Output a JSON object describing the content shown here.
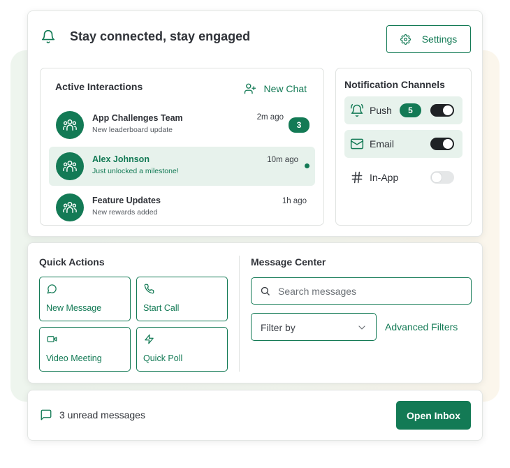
{
  "header": {
    "title": "Stay connected, stay engaged",
    "settings_label": "Settings"
  },
  "interactions": {
    "title": "Active Interactions",
    "new_chat_label": "New Chat",
    "items": [
      {
        "name": "App Challenges Team",
        "subtitle": "New leaderboard update",
        "time": "2m ago",
        "badge": "3"
      },
      {
        "name": "Alex Johnson",
        "subtitle": "Just unlocked a milestone!",
        "time": "10m ago"
      },
      {
        "name": "Feature Updates",
        "subtitle": "New rewards added",
        "time": "1h ago"
      }
    ]
  },
  "channels": {
    "title": "Notification Channels",
    "items": [
      {
        "label": "Push",
        "badge": "5",
        "enabled": true
      },
      {
        "label": "Email",
        "enabled": true
      },
      {
        "label": "In-App",
        "enabled": false
      }
    ]
  },
  "quick_actions": {
    "title": "Quick Actions",
    "items": [
      {
        "label": "New Message"
      },
      {
        "label": "Start Call"
      },
      {
        "label": "Video Meeting"
      },
      {
        "label": "Quick Poll"
      }
    ]
  },
  "message_center": {
    "title": "Message Center",
    "search_placeholder": "Search messages",
    "filter_label": "Filter by",
    "advanced_filters_label": "Advanced Filters"
  },
  "footer": {
    "unread_text": "3 unread messages",
    "open_inbox_label": "Open Inbox"
  },
  "colors": {
    "accent": "#137a55",
    "accent_light": "#e7f2ec",
    "toggle_on": "#1f2225"
  }
}
